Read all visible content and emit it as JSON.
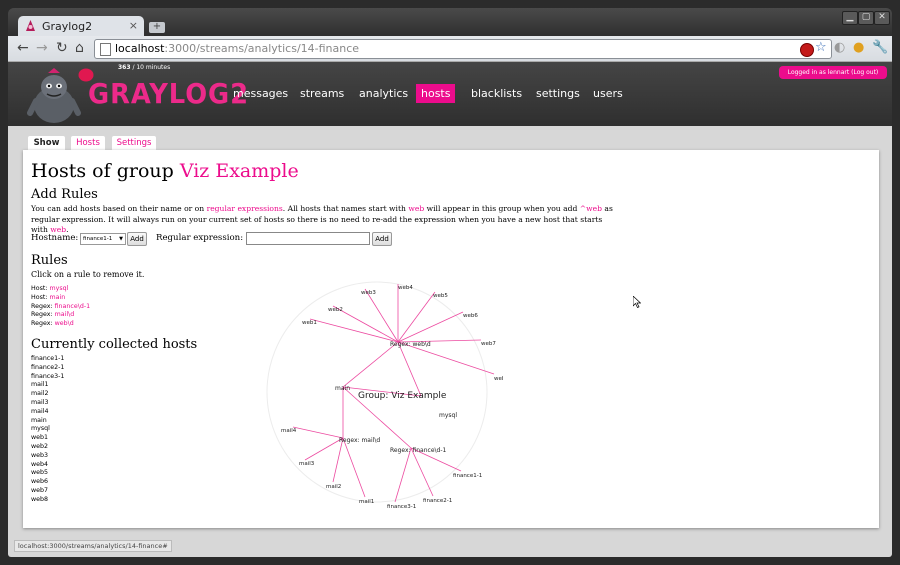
{
  "browser": {
    "tab_title": "Graylog2",
    "tab_close": "×",
    "newtab": "+",
    "url_host": "localhost",
    "url_path": ":3000/streams/analytics/14-finance",
    "status_url": "localhost:3000/streams/analytics/14-finance#"
  },
  "header": {
    "counter_value": "363",
    "counter_suffix": " / 10 minutes",
    "logo_text": "GRAYLOG2",
    "nav": [
      {
        "label": "messages",
        "active": false
      },
      {
        "label": "streams",
        "active": false
      },
      {
        "label": "analytics",
        "active": false
      },
      {
        "label": "hosts",
        "active": true
      },
      {
        "label": "blacklists",
        "active": false
      },
      {
        "label": "settings",
        "active": false
      },
      {
        "label": "users",
        "active": false
      }
    ],
    "login_text": "Logged in as lennart",
    "logout_text": "(Log out)"
  },
  "subtabs": [
    {
      "label": "Show",
      "active": true
    },
    {
      "label": "Hosts",
      "active": false
    },
    {
      "label": "Settings",
      "active": false
    }
  ],
  "page": {
    "title_prefix": "Hosts of group ",
    "title_group": "Viz Example",
    "add_rules_heading": "Add Rules",
    "intro": {
      "t1": "You can add hosts based on their name or on ",
      "link1": "regular expressions",
      "t2": ". All hosts that names start with ",
      "web1": "web",
      "t3": " will appear in this group when you add ",
      "regex": "^web",
      "t4": " as regular expression. It will always run on your current set of hosts so there is no need to re-add the expression when you have a new host that starts with ",
      "web2": "web",
      "t5": "."
    },
    "hostname_label": "Hostname:",
    "hostname_selected": "finance1-1",
    "add_label": "Add",
    "regex_label": "Regular expression:",
    "regex_value": "",
    "rules_heading": "Rules",
    "rules_hint": "Click on a rule to remove it.",
    "rules": [
      {
        "type": "Host:",
        "value": "mysql"
      },
      {
        "type": "Host:",
        "value": "main"
      },
      {
        "type": "Regex:",
        "value": "finance\\d-1"
      },
      {
        "type": "Regex:",
        "value": "mail\\d"
      },
      {
        "type": "Regex:",
        "value": "web\\d"
      }
    ],
    "collected_heading": "Currently collected hosts",
    "hosts": [
      "finance1-1",
      "finance2-1",
      "finance3-1",
      "mail1",
      "mail2",
      "mail3",
      "mail4",
      "main",
      "mysql",
      "web1",
      "web2",
      "web3",
      "web4",
      "web5",
      "web6",
      "web7",
      "web8"
    ]
  },
  "graph": {
    "center_label": "Group: Viz Example",
    "nodes": {
      "web": "Regex: web\\d",
      "mail": "Regex: mail\\d",
      "finance": "Regex: finance\\d-1",
      "main": "main",
      "mysql": "mysql"
    },
    "web_leaves": [
      "web1",
      "web2",
      "web3",
      "web4",
      "web5",
      "web6",
      "web7",
      "web8"
    ],
    "mail_leaves": [
      "mail4",
      "mail3",
      "mail2",
      "mail1"
    ],
    "finance_leaves": [
      "finance1-1",
      "finance2-1",
      "finance3-1"
    ]
  },
  "colors": {
    "accent": "#ec0c8c",
    "header": "#333333"
  }
}
